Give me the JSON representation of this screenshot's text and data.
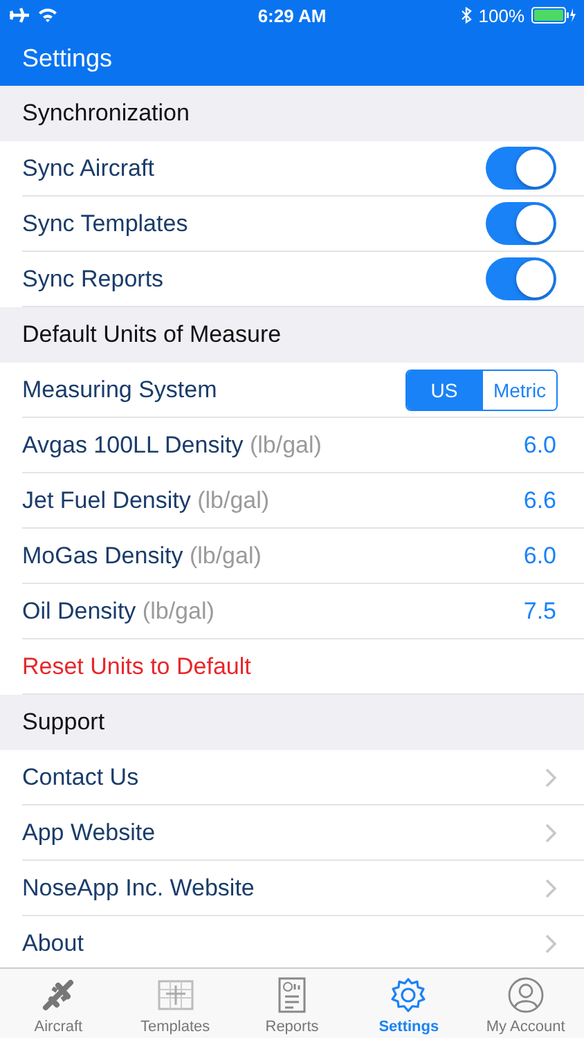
{
  "status_bar": {
    "time": "6:29 AM",
    "battery": "100%"
  },
  "nav": {
    "title": "Settings"
  },
  "sections": [
    {
      "title": "Synchronization",
      "rows": [
        {
          "kind": "toggle",
          "label": "Sync Aircraft",
          "on": true
        },
        {
          "kind": "toggle",
          "label": "Sync Templates",
          "on": true
        },
        {
          "kind": "toggle",
          "label": "Sync Reports",
          "on": true
        }
      ]
    },
    {
      "title": "Default Units of Measure",
      "rows": [
        {
          "kind": "segmented",
          "label": "Measuring System",
          "options": [
            {
              "label": "US",
              "selected": true
            },
            {
              "label": "Metric",
              "selected": false
            }
          ]
        },
        {
          "kind": "value",
          "label": "Avgas 100LL Density",
          "unit": "(lb/gal)",
          "value": "6.0"
        },
        {
          "kind": "value",
          "label": "Jet Fuel Density",
          "unit": "(lb/gal)",
          "value": "6.6"
        },
        {
          "kind": "value",
          "label": "MoGas Density",
          "unit": "(lb/gal)",
          "value": "6.0"
        },
        {
          "kind": "value",
          "label": "Oil Density",
          "unit": "(lb/gal)",
          "value": "7.5"
        },
        {
          "kind": "action",
          "label": "Reset Units to Default"
        }
      ]
    },
    {
      "title": "Support",
      "rows": [
        {
          "kind": "link",
          "label": "Contact Us"
        },
        {
          "kind": "link",
          "label": "App Website"
        },
        {
          "kind": "link",
          "label": "NoseApp Inc. Website"
        },
        {
          "kind": "link",
          "label": "About"
        }
      ]
    }
  ],
  "tab_bar": [
    {
      "kind": "aircraft",
      "label": "Aircraft",
      "selected": false
    },
    {
      "kind": "templates",
      "label": "Templates",
      "selected": false
    },
    {
      "kind": "reports",
      "label": "Reports",
      "selected": false
    },
    {
      "kind": "settings",
      "label": "Settings",
      "selected": true
    },
    {
      "kind": "account",
      "label": "My Account",
      "selected": false
    }
  ]
}
